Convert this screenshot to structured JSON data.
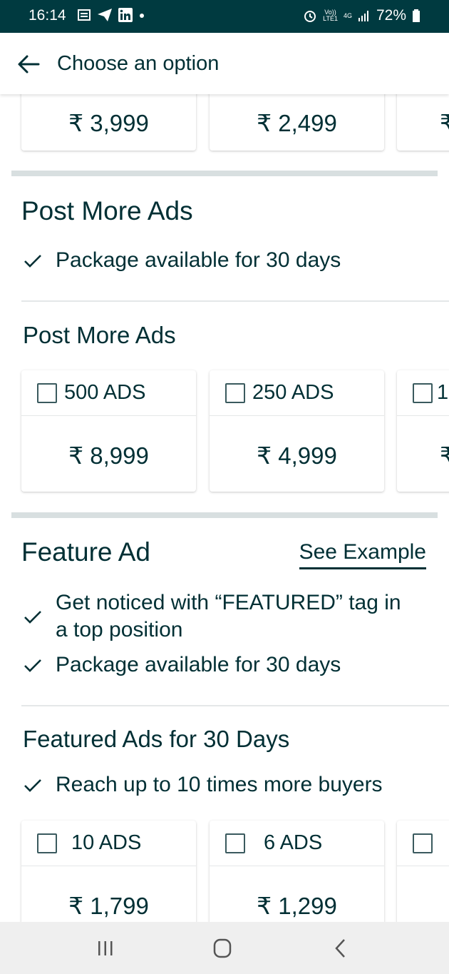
{
  "status_bar": {
    "time": "16:14",
    "battery": "72%",
    "volte_top": "Vo))",
    "volte_bottom": "LTE1",
    "network": "4G"
  },
  "header": {
    "title": "Choose an option"
  },
  "top_package": {
    "prices": [
      "₹ 3,999",
      "₹ 2,499",
      "₹"
    ]
  },
  "post_more_ads": {
    "section_title": "Post More Ads",
    "feature": "Package available for 30 days",
    "sub_title": "Post More Ads",
    "options": [
      {
        "label": "500 ADS",
        "price": "₹ 8,999"
      },
      {
        "label": "250 ADS",
        "price": "₹ 4,999"
      },
      {
        "label": "1",
        "price": "₹"
      }
    ]
  },
  "feature_ad": {
    "section_title": "Feature Ad",
    "see_example": "See Example",
    "features": [
      "Get noticed with “FEATURED” tag in",
      "a top position",
      "Package available for 30 days"
    ],
    "sub_title": "Featured Ads for 30 Days",
    "sub_feature": "Reach up to 10 times more buyers",
    "options": [
      {
        "label": "10 ADS",
        "price": "₹ 1,799"
      },
      {
        "label": "6 ADS",
        "price": "₹ 1,299"
      },
      {
        "label": "",
        "price": ""
      }
    ]
  },
  "colors": {
    "status_bar": "#003a40",
    "text": "#002f34",
    "divider": "#d8dfe0"
  }
}
